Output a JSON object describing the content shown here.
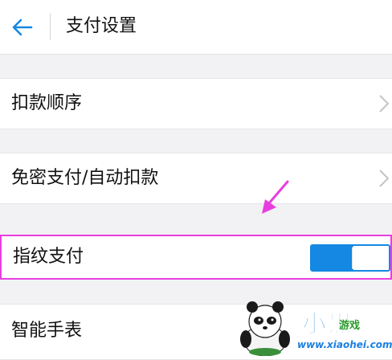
{
  "header": {
    "title": "支付设置",
    "back_icon": "arrow-left-icon"
  },
  "rows": [
    {
      "label": "扣款顺序",
      "icon": "chevron-right-icon"
    },
    {
      "label": "免密支付/自动扣款",
      "icon": "chevron-right-icon"
    },
    {
      "label": "指纹支付",
      "toggle_on": true
    },
    {
      "label": "智能手表"
    }
  ],
  "watermark": {
    "brand": "小黑",
    "tag": "游戏",
    "url": "www.xiaohei.com"
  },
  "colors": {
    "accent": "#1488e2",
    "highlight": "#e83ee0",
    "background": "#f2f2f4"
  }
}
